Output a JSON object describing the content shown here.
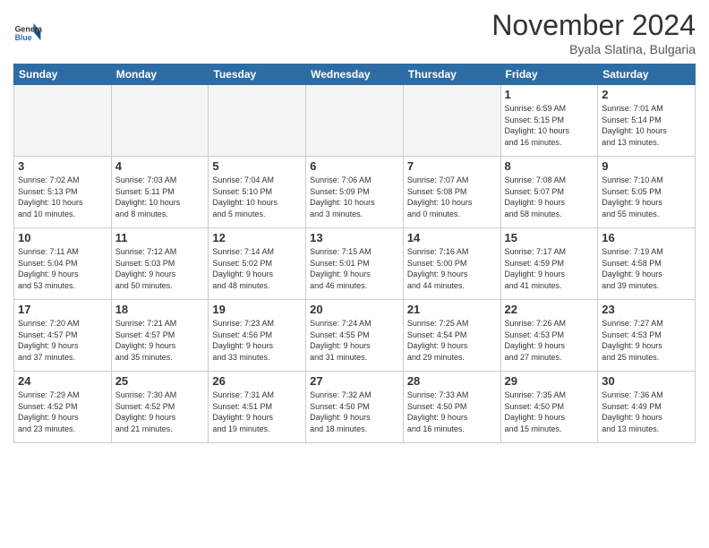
{
  "header": {
    "logo_line1": "General",
    "logo_line2": "Blue",
    "month": "November 2024",
    "location": "Byala Slatina, Bulgaria"
  },
  "days_of_week": [
    "Sunday",
    "Monday",
    "Tuesday",
    "Wednesday",
    "Thursday",
    "Friday",
    "Saturday"
  ],
  "weeks": [
    [
      {
        "num": "",
        "info": ""
      },
      {
        "num": "",
        "info": ""
      },
      {
        "num": "",
        "info": ""
      },
      {
        "num": "",
        "info": ""
      },
      {
        "num": "",
        "info": ""
      },
      {
        "num": "1",
        "info": "Sunrise: 6:59 AM\nSunset: 5:15 PM\nDaylight: 10 hours\nand 16 minutes."
      },
      {
        "num": "2",
        "info": "Sunrise: 7:01 AM\nSunset: 5:14 PM\nDaylight: 10 hours\nand 13 minutes."
      }
    ],
    [
      {
        "num": "3",
        "info": "Sunrise: 7:02 AM\nSunset: 5:13 PM\nDaylight: 10 hours\nand 10 minutes."
      },
      {
        "num": "4",
        "info": "Sunrise: 7:03 AM\nSunset: 5:11 PM\nDaylight: 10 hours\nand 8 minutes."
      },
      {
        "num": "5",
        "info": "Sunrise: 7:04 AM\nSunset: 5:10 PM\nDaylight: 10 hours\nand 5 minutes."
      },
      {
        "num": "6",
        "info": "Sunrise: 7:06 AM\nSunset: 5:09 PM\nDaylight: 10 hours\nand 3 minutes."
      },
      {
        "num": "7",
        "info": "Sunrise: 7:07 AM\nSunset: 5:08 PM\nDaylight: 10 hours\nand 0 minutes."
      },
      {
        "num": "8",
        "info": "Sunrise: 7:08 AM\nSunset: 5:07 PM\nDaylight: 9 hours\nand 58 minutes."
      },
      {
        "num": "9",
        "info": "Sunrise: 7:10 AM\nSunset: 5:05 PM\nDaylight: 9 hours\nand 55 minutes."
      }
    ],
    [
      {
        "num": "10",
        "info": "Sunrise: 7:11 AM\nSunset: 5:04 PM\nDaylight: 9 hours\nand 53 minutes."
      },
      {
        "num": "11",
        "info": "Sunrise: 7:12 AM\nSunset: 5:03 PM\nDaylight: 9 hours\nand 50 minutes."
      },
      {
        "num": "12",
        "info": "Sunrise: 7:14 AM\nSunset: 5:02 PM\nDaylight: 9 hours\nand 48 minutes."
      },
      {
        "num": "13",
        "info": "Sunrise: 7:15 AM\nSunset: 5:01 PM\nDaylight: 9 hours\nand 46 minutes."
      },
      {
        "num": "14",
        "info": "Sunrise: 7:16 AM\nSunset: 5:00 PM\nDaylight: 9 hours\nand 44 minutes."
      },
      {
        "num": "15",
        "info": "Sunrise: 7:17 AM\nSunset: 4:59 PM\nDaylight: 9 hours\nand 41 minutes."
      },
      {
        "num": "16",
        "info": "Sunrise: 7:19 AM\nSunset: 4:58 PM\nDaylight: 9 hours\nand 39 minutes."
      }
    ],
    [
      {
        "num": "17",
        "info": "Sunrise: 7:20 AM\nSunset: 4:57 PM\nDaylight: 9 hours\nand 37 minutes."
      },
      {
        "num": "18",
        "info": "Sunrise: 7:21 AM\nSunset: 4:57 PM\nDaylight: 9 hours\nand 35 minutes."
      },
      {
        "num": "19",
        "info": "Sunrise: 7:23 AM\nSunset: 4:56 PM\nDaylight: 9 hours\nand 33 minutes."
      },
      {
        "num": "20",
        "info": "Sunrise: 7:24 AM\nSunset: 4:55 PM\nDaylight: 9 hours\nand 31 minutes."
      },
      {
        "num": "21",
        "info": "Sunrise: 7:25 AM\nSunset: 4:54 PM\nDaylight: 9 hours\nand 29 minutes."
      },
      {
        "num": "22",
        "info": "Sunrise: 7:26 AM\nSunset: 4:53 PM\nDaylight: 9 hours\nand 27 minutes."
      },
      {
        "num": "23",
        "info": "Sunrise: 7:27 AM\nSunset: 4:53 PM\nDaylight: 9 hours\nand 25 minutes."
      }
    ],
    [
      {
        "num": "24",
        "info": "Sunrise: 7:29 AM\nSunset: 4:52 PM\nDaylight: 9 hours\nand 23 minutes."
      },
      {
        "num": "25",
        "info": "Sunrise: 7:30 AM\nSunset: 4:52 PM\nDaylight: 9 hours\nand 21 minutes."
      },
      {
        "num": "26",
        "info": "Sunrise: 7:31 AM\nSunset: 4:51 PM\nDaylight: 9 hours\nand 19 minutes."
      },
      {
        "num": "27",
        "info": "Sunrise: 7:32 AM\nSunset: 4:50 PM\nDaylight: 9 hours\nand 18 minutes."
      },
      {
        "num": "28",
        "info": "Sunrise: 7:33 AM\nSunset: 4:50 PM\nDaylight: 9 hours\nand 16 minutes."
      },
      {
        "num": "29",
        "info": "Sunrise: 7:35 AM\nSunset: 4:50 PM\nDaylight: 9 hours\nand 15 minutes."
      },
      {
        "num": "30",
        "info": "Sunrise: 7:36 AM\nSunset: 4:49 PM\nDaylight: 9 hours\nand 13 minutes."
      }
    ]
  ]
}
